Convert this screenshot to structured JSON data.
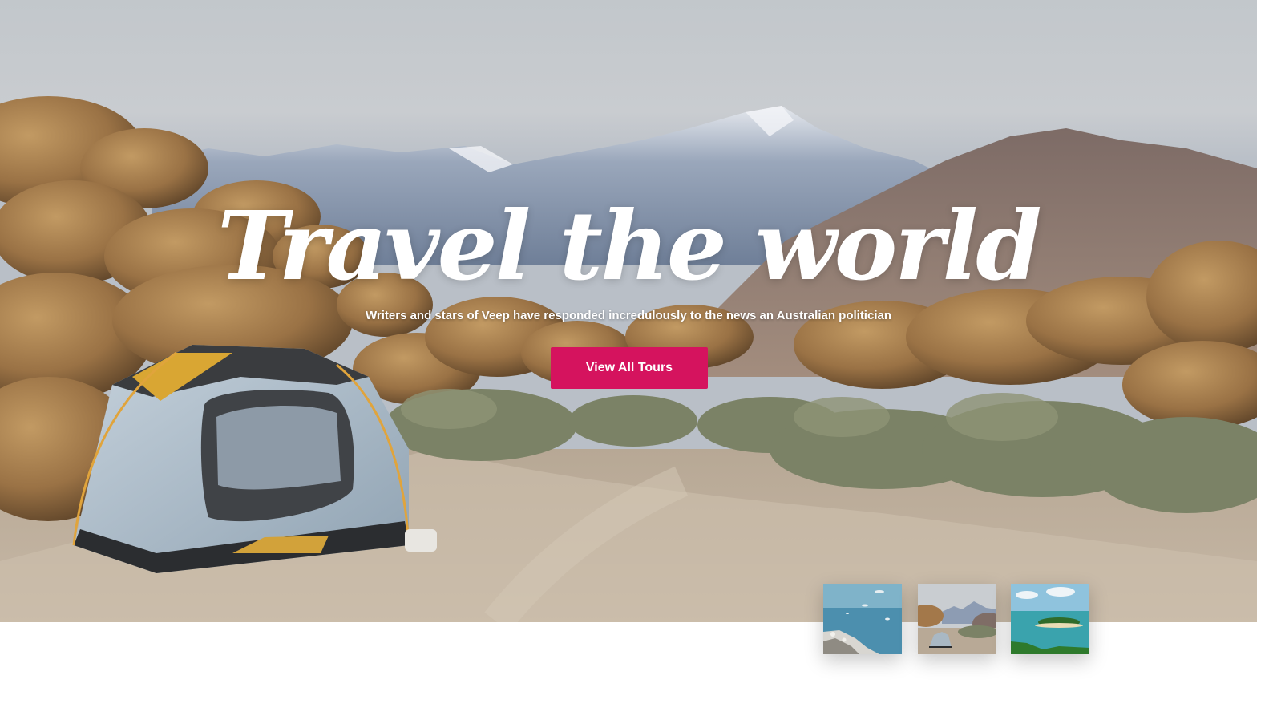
{
  "hero": {
    "title": "Travel the world",
    "subtitle": "Writers and stars of Veep have responded incredulously to the news an Australian politician",
    "cta_label": "View All Tours",
    "accent_color": "#d5135e"
  },
  "gallery": {
    "thumbnails": [
      {
        "name": "coast-rocks-thumbnail"
      },
      {
        "name": "tent-desert-thumbnail"
      },
      {
        "name": "tropical-island-thumbnail"
      }
    ]
  }
}
